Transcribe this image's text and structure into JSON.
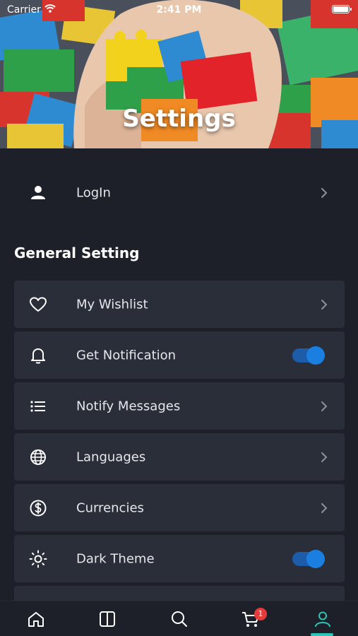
{
  "status_bar": {
    "carrier": "Carrier",
    "time": "2:41 PM"
  },
  "header": {
    "title": "Settings"
  },
  "login": {
    "label": "LogIn",
    "icon": "user-icon"
  },
  "section": {
    "title": "General Setting"
  },
  "items": [
    {
      "label": "My Wishlist",
      "icon": "heart-icon",
      "control": "chevron"
    },
    {
      "label": "Get Notification",
      "icon": "bell-icon",
      "control": "toggle",
      "on": true
    },
    {
      "label": "Notify Messages",
      "icon": "list-icon",
      "control": "chevron"
    },
    {
      "label": "Languages",
      "icon": "globe-icon",
      "control": "chevron"
    },
    {
      "label": "Currencies",
      "icon": "dollar-icon",
      "control": "chevron"
    },
    {
      "label": "Dark Theme",
      "icon": "sun-icon",
      "control": "toggle",
      "on": true
    }
  ],
  "tabbar": {
    "tabs": [
      "home-icon",
      "columns-icon",
      "search-icon",
      "cart-icon",
      "profile-icon"
    ],
    "cart_badge": "1",
    "active": "profile-icon"
  },
  "colors": {
    "background": "#1d2029",
    "card": "#2a2e39",
    "toggle": "#1a7fe0",
    "active_tab": "#2ec4b6",
    "badge": "#e63b3b"
  }
}
